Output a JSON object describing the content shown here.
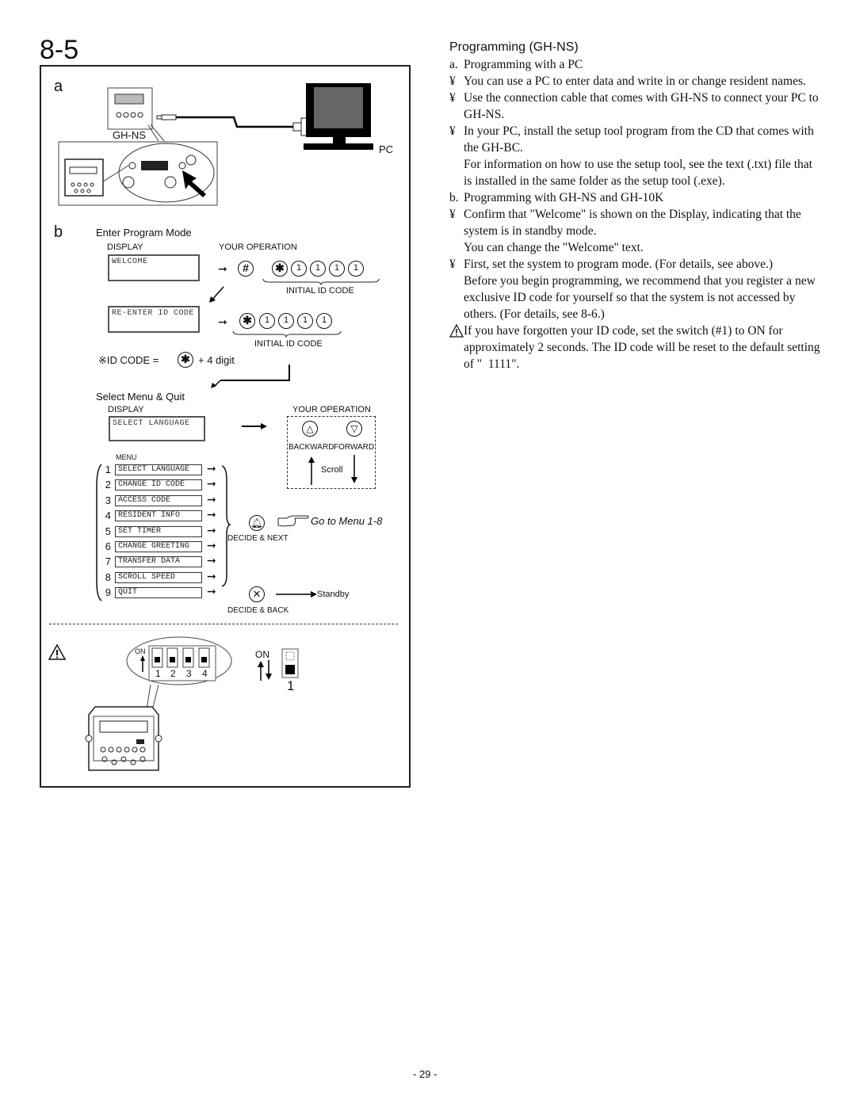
{
  "section_number": "8-5",
  "diagram": {
    "part_a": {
      "letter": "a",
      "device_label": "GH-NS",
      "pc_label": "PC"
    },
    "part_b": {
      "letter": "b",
      "enter_program_mode": {
        "title": "Enter Program Mode",
        "display_header": "DISPLAY",
        "operation_header": "YOUR OPERATION",
        "display_1": "WELCOME",
        "display_2": "RE-ENTER ID CODE",
        "hash_key": "#",
        "star_key": "✱",
        "digit_keys": [
          "1",
          "1",
          "1",
          "1"
        ],
        "initial_id_code_label": "INITIAL ID CODE",
        "id_code_note_prefix": "※ID CODE =",
        "id_code_note_suffix": "+ 4 digit"
      },
      "select_menu": {
        "title": "Select Menu & Quit",
        "display_header": "DISPLAY",
        "operation_header": "YOUR OPERATION",
        "display_text": "SELECT LANGUAGE",
        "menu_header": "MENU",
        "backward_label": "BACKWARD",
        "forward_label": "FORWARD",
        "scroll_label": "Scroll",
        "up_key": "△",
        "down_key": "▽",
        "menu_items": [
          {
            "num": "1",
            "label": "SELECT LANGUAGE"
          },
          {
            "num": "2",
            "label": "CHANGE ID CODE"
          },
          {
            "num": "3",
            "label": "ACCESS CODE"
          },
          {
            "num": "4",
            "label": "RESIDENT INFO"
          },
          {
            "num": "5",
            "label": "SET TIMER"
          },
          {
            "num": "6",
            "label": "CHANGE GREETING"
          },
          {
            "num": "7",
            "label": "TRANSFER DATA"
          },
          {
            "num": "8",
            "label": "SCROLL SPEED"
          },
          {
            "num": "9",
            "label": "QUIT"
          }
        ],
        "decide_next_label": "DECIDE & NEXT",
        "go_to_menu": "Go to Menu 1-8",
        "decide_back_label": "DECIDE & BACK",
        "standby_label": "Standby"
      }
    },
    "dip_switch": {
      "on_label": "ON",
      "switch_numbers": [
        "1",
        "2",
        "3",
        "4"
      ],
      "single_switch_on_label": "ON",
      "single_switch_number": "1"
    }
  },
  "text": {
    "heading": "Programming (GH-NS)",
    "item_a": {
      "marker": "a.",
      "text": "Programming with a PC"
    },
    "bullets_a": [
      "You can use a PC to enter data and write in or change resident names.",
      "Use the connection cable that comes with GH-NS to connect your PC to GH-NS.",
      "In your PC, install the setup tool program from the CD that comes with the GH-BC."
    ],
    "note_a": "For information on how to use the setup tool, see the text (.txt) file that is installed in the same folder as the setup tool (.exe).",
    "item_b": {
      "marker": "b.",
      "text": "Programming with GH-NS and GH-10K"
    },
    "bullet_b1": "Confirm that \"Welcome\" is shown on the Display, indicating that the system is in standby mode.",
    "note_b1": "You can change the \"Welcome\" text.",
    "bullet_b2": "First, set the system to program mode. (For details, see above.)",
    "note_b2": "Before you begin programming, we recommend that you register a new exclusive ID code for yourself so that the system is not accessed by others. (For details, see 8-6.)",
    "warning": "If you have forgotten your ID code, set the switch (#1) to ON for approximately 2 seconds. The ID code will be reset to the default setting of \"  1111\".",
    "bullet_marker": "¥"
  },
  "page_number": "- 29 -"
}
